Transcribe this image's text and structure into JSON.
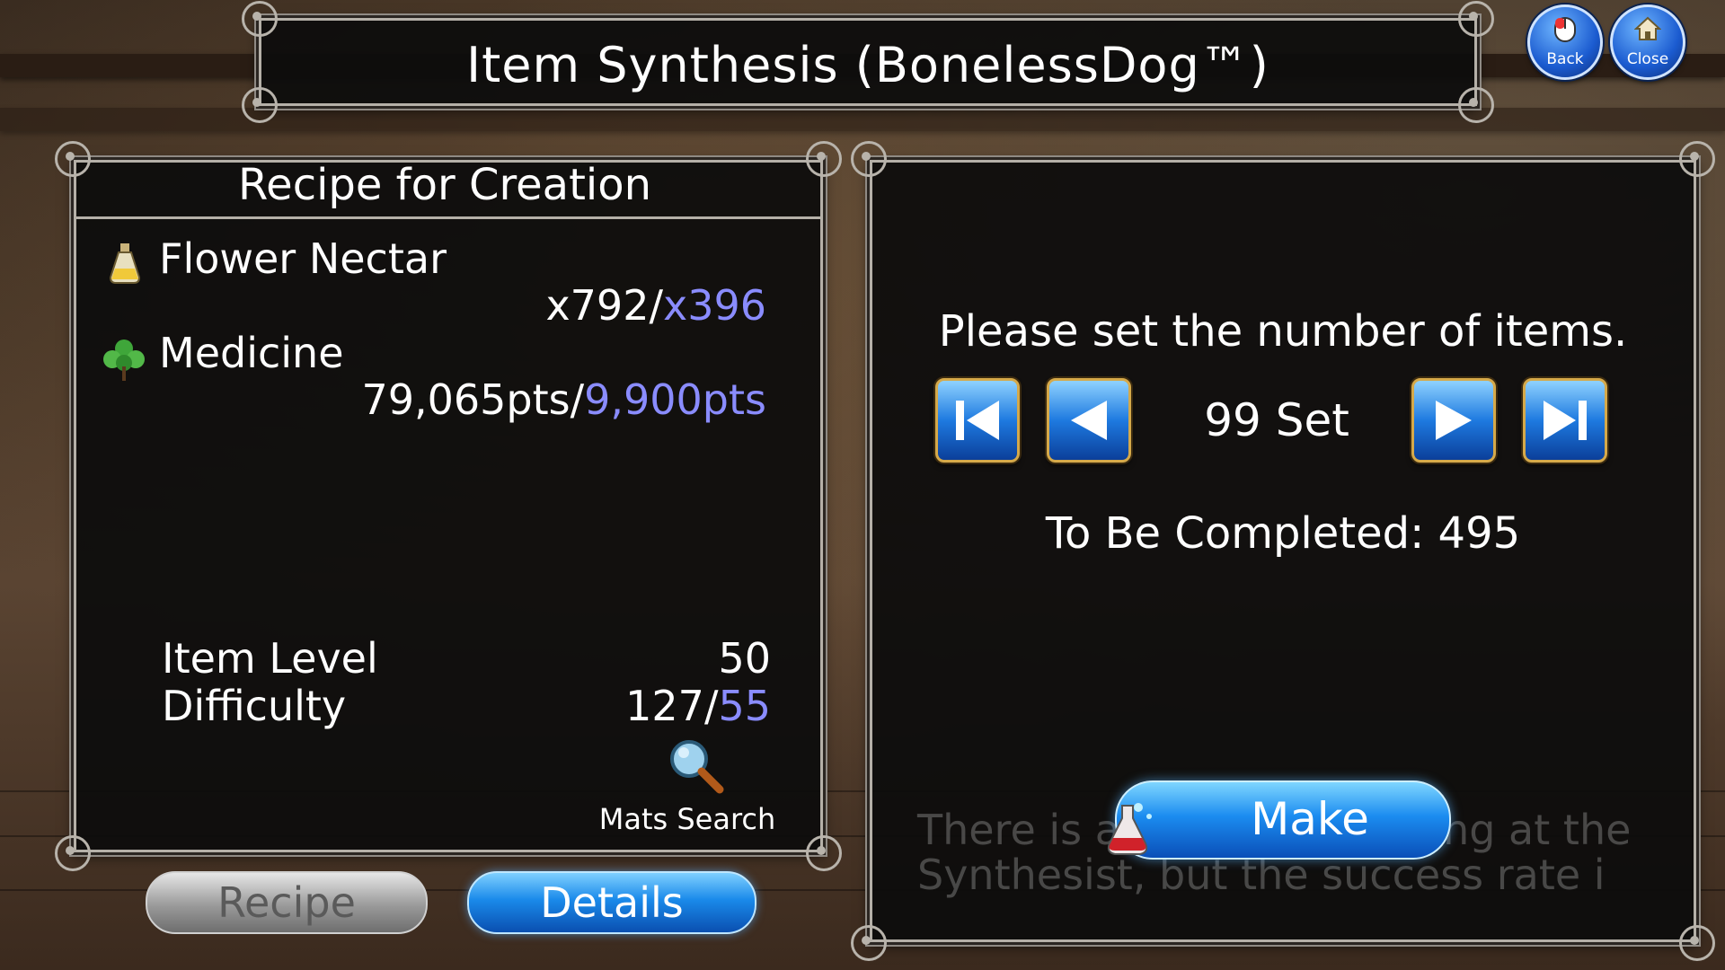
{
  "header": {
    "title": "Item Synthesis (BonelessDog™)",
    "back_label": "Back",
    "close_label": "Close"
  },
  "recipe_panel": {
    "heading": "Recipe for Creation",
    "materials": [
      {
        "name": "Flower Nectar",
        "icon": "potion-bottle-icon",
        "owned": "x792/",
        "required": "x396"
      },
      {
        "name": "Medicine",
        "icon": "herb-leaf-icon",
        "owned": "79,065pts/",
        "required": "9,900pts"
      }
    ],
    "item_level_label": "Item Level",
    "item_level_value": "50",
    "difficulty_label": "Difficulty",
    "difficulty_current": "127/",
    "difficulty_required": "55",
    "mats_search_label": "Mats Search"
  },
  "tabs": {
    "recipe_label": "Recipe",
    "details_label": "Details",
    "active": "Details"
  },
  "count_panel": {
    "prompt": "Please set the number of items.",
    "set_count": "99 Set",
    "to_be_completed": "To Be Completed: 495",
    "faded_note_line1": "There is a bonus for making at the",
    "faded_note_line2": "Synthesist, but the success rate i",
    "make_label": "Make"
  },
  "colors": {
    "highlight_blue": "#8a8cff",
    "button_blue": "#1b8cf0",
    "panel_border": "#b5b0a8"
  }
}
